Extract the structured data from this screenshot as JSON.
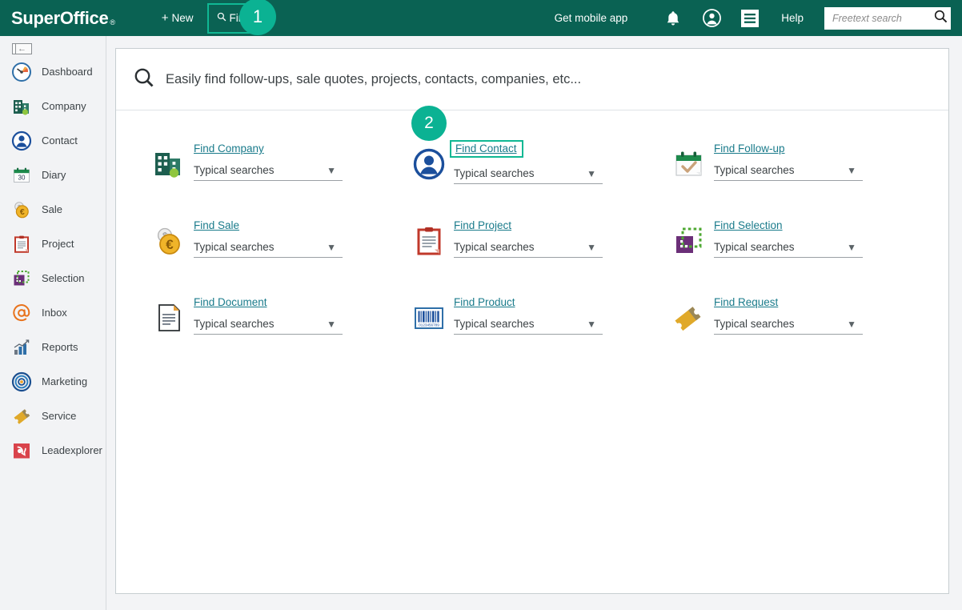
{
  "topbar": {
    "logo": "SuperOffice",
    "logo_mark": "®",
    "new_label": "New",
    "new_icon": "plus-icon",
    "find_label": "Find",
    "find_icon": "search-icon",
    "get_mobile_app": "Get mobile app",
    "bell_icon": "bell-icon",
    "profile_icon": "user-icon",
    "menu_icon": "hamburger-menu-icon",
    "help_label": "Help",
    "freetext_placeholder": "Freetext search",
    "freetext_value": "",
    "freetext_search_icon": "search-icon",
    "accent_color": "#0bb293",
    "bar_color": "#0a6253"
  },
  "badges": [
    {
      "id": "badge-1",
      "label": "1"
    },
    {
      "id": "badge-2",
      "label": "2"
    }
  ],
  "sidebar": {
    "collapse_icon": "collapse-panel-icon",
    "items": [
      {
        "label": "Dashboard",
        "icon": "dashboard-gauge-icon"
      },
      {
        "label": "Company",
        "icon": "company-building-icon"
      },
      {
        "label": "Contact",
        "icon": "contact-person-icon"
      },
      {
        "label": "Diary",
        "icon": "calendar-icon"
      },
      {
        "label": "Sale",
        "icon": "coin-euro-icon"
      },
      {
        "label": "Project",
        "icon": "clipboard-icon"
      },
      {
        "label": "Selection",
        "icon": "selection-marquee-icon"
      },
      {
        "label": "Inbox",
        "icon": "at-sign-icon"
      },
      {
        "label": "Reports",
        "icon": "bar-chart-icon"
      },
      {
        "label": "Marketing",
        "icon": "target-rings-icon"
      },
      {
        "label": "Service",
        "icon": "ticket-icon"
      },
      {
        "label": "Leadexplorer",
        "icon": "leadexplorer-phone-icon"
      }
    ]
  },
  "main": {
    "search": {
      "icon": "search-icon",
      "placeholder": "Easily find follow-ups, sale quotes, projects, contacts, companies, etc..."
    },
    "dropdown_label": "Typical searches",
    "dropdown_icon": "chevron-down-icon",
    "tiles": [
      {
        "link": "Find Company",
        "icon": "company-building-icon",
        "dropdown": "Typical searches",
        "highlighted": false
      },
      {
        "link": "Find Contact",
        "icon": "contact-person-icon",
        "dropdown": "Typical searches",
        "highlighted": true
      },
      {
        "link": "Find Follow-up",
        "icon": "calendar-check-icon",
        "dropdown": "Typical searches",
        "highlighted": false
      },
      {
        "link": "Find Sale",
        "icon": "coin-euro-icon",
        "dropdown": "Typical searches",
        "highlighted": false
      },
      {
        "link": "Find Project",
        "icon": "clipboard-icon",
        "dropdown": "Typical searches",
        "highlighted": false
      },
      {
        "link": "Find Selection",
        "icon": "selection-marquee-icon",
        "dropdown": "Typical searches",
        "highlighted": false
      },
      {
        "link": "Find Document",
        "icon": "document-page-icon",
        "dropdown": "Typical searches",
        "highlighted": false
      },
      {
        "link": "Find Product",
        "icon": "barcode-icon",
        "dropdown": "Typical searches",
        "highlighted": false
      },
      {
        "link": "Find Request",
        "icon": "ticket-icon",
        "dropdown": "Typical searches",
        "highlighted": false
      }
    ]
  }
}
